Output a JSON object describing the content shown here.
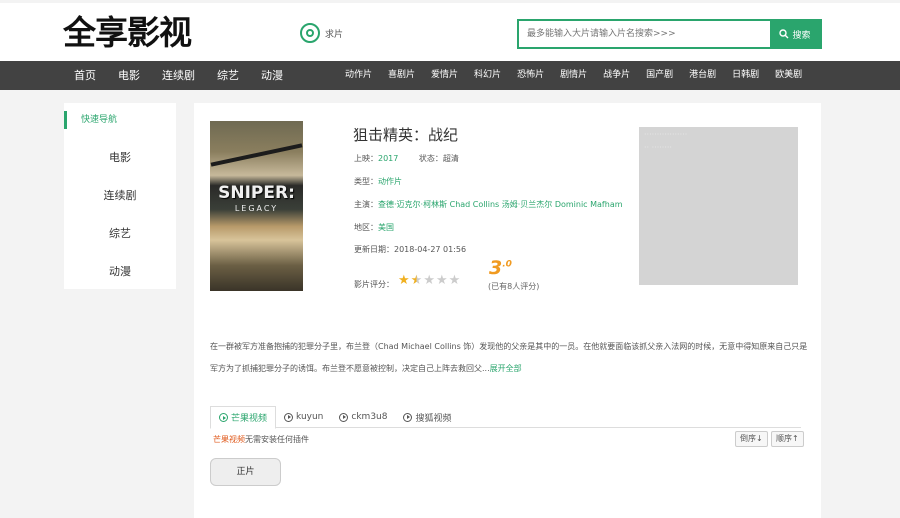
{
  "site": {
    "logo": "全享影视",
    "qiupian_label": "求片"
  },
  "search": {
    "placeholder": "最多能输入大片请输入片名搜索>>>",
    "button_label": "搜索"
  },
  "nav": {
    "main": [
      "首页",
      "电影",
      "连续剧",
      "综艺",
      "动漫"
    ],
    "genres": [
      "动作片",
      "喜剧片",
      "爱情片",
      "科幻片",
      "恐怖片",
      "剧情片",
      "战争片",
      "国产剧",
      "港台剧",
      "日韩剧",
      "欧美剧"
    ]
  },
  "sidebar": {
    "title": "快速导航",
    "items": [
      "电影",
      "连续剧",
      "综艺",
      "动漫"
    ]
  },
  "poster": {
    "title": "SNIPER:",
    "subtitle": "LEGACY"
  },
  "movie": {
    "title": "狙击精英：战纪",
    "year_label": "上映：",
    "year": "2017",
    "status_label": "状态：",
    "status": "超清",
    "type_label": "类型：",
    "type": "动作片",
    "cast_label": "主演：",
    "cast": "查德·迈克尔·柯林斯 Chad Collins 汤姆·贝兰杰尔 Dominic Mafham",
    "region_label": "地区：",
    "region": "美国",
    "updated_label": "更新日期：",
    "updated": "2018-04-27 01:56",
    "rating_label": "影片评分：",
    "rating_stars": 1.5,
    "score_main": "3",
    "score_decimal": ".0",
    "score_count": "(已有8人评分)"
  },
  "ad_box": {
    "line1": "·················",
    "line2": "·· ········"
  },
  "description": {
    "text": "在一群被军方准备抱捕的犯罪分子里，布兰登（Chad Michael Collins 饰）发现他的父亲是其中的一员。在他就要面临该抓父亲入法网的时候，无意中得知原来自己只是军方为了抓捕犯罪分子的诱饵。布兰登不愿意被控制，决定自己上阵去救回父...",
    "more_label": "展开全部"
  },
  "sources": {
    "tabs": [
      "芒果视频",
      "kuyun",
      "ckm3u8",
      "搜狐视频"
    ],
    "notice_highlight": "芒果视频",
    "notice_rest": "无需安装任何插件",
    "sort_asc": "倒序↓",
    "sort_desc": "顺序↑",
    "episode": "正片"
  },
  "colors": {
    "accent": "#2aa56d",
    "nav_bg": "#424242",
    "score": "#f09a21"
  }
}
